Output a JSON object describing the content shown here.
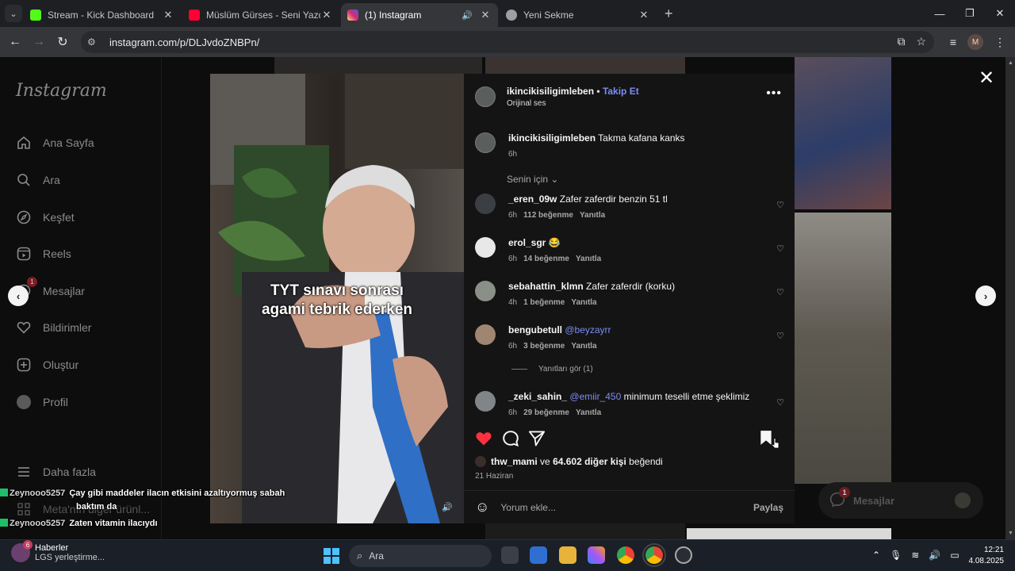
{
  "browser": {
    "tabs": [
      {
        "title": "Stream - Kick Dashboard",
        "favicon_color": "#53fc18",
        "active": false
      },
      {
        "title": "Müslüm Gürses - Seni Yazdım -",
        "favicon_color": "#ff0033",
        "active": false
      },
      {
        "title": "(1) Instagram",
        "favicon_color": "#d62976",
        "active": true
      },
      {
        "title": "Yeni Sekme",
        "favicon_color": "#9aa0a6",
        "active": false
      }
    ],
    "url": "instagram.com/p/DLJvdoZNBPn/",
    "profile_initial": "M"
  },
  "sidebar": {
    "logo": "Instagram",
    "items": [
      {
        "label": "Ana Sayfa",
        "icon": "home-icon"
      },
      {
        "label": "Ara",
        "icon": "search-icon"
      },
      {
        "label": "Keşfet",
        "icon": "compass-icon"
      },
      {
        "label": "Reels",
        "icon": "reels-icon"
      },
      {
        "label": "Mesajlar",
        "icon": "messenger-icon",
        "badge": "1"
      },
      {
        "label": "Bildirimler",
        "icon": "heart-icon"
      },
      {
        "label": "Oluştur",
        "icon": "plus-icon"
      },
      {
        "label": "Profil",
        "icon": "profile-icon"
      }
    ],
    "more": "Daha fazla",
    "meta": "Meta'nın diğer ürünl..."
  },
  "post": {
    "caption_line1": "TYT sınavı sonrası",
    "caption_line2": "agami tebrik ederken",
    "author": "ikincikisiligimleben",
    "follow": "Takip Et",
    "audio": "Orijinal ses",
    "owner_comment": {
      "user": "ikincikisiligimleben",
      "text": "Takma kafana kanks",
      "time": "6h"
    },
    "for_you": "Senin için",
    "comments": [
      {
        "user": "_eren_09w",
        "text": "Zafer zaferdir benzin 51 tl",
        "mention": "",
        "time": "6h",
        "likes": "112 beğenme",
        "reply": "Yanıtla"
      },
      {
        "user": "erol_sgr",
        "text": "😂",
        "mention": "",
        "time": "6h",
        "likes": "14 beğenme",
        "reply": "Yanıtla"
      },
      {
        "user": "sebahattin_klmn",
        "text": "Zafer zaferdir (korku)",
        "mention": "",
        "time": "4h",
        "likes": "1 beğenme",
        "reply": "Yanıtla"
      },
      {
        "user": "bengubetull",
        "text": "",
        "mention": "@beyzayrr",
        "time": "6h",
        "likes": "3 beğenme",
        "reply": "Yanıtla"
      },
      {
        "user": "_zeki_sahin_",
        "text": "minimum teselli etme şeklimiz",
        "mention": "@emiir_450",
        "time": "6h",
        "likes": "29 beğenme",
        "reply": "Yanıtla"
      }
    ],
    "view_replies": "Yanıtları gör (1)",
    "liked_by_user": "thw_mami",
    "liked_by_and": "ve",
    "liked_by_count": "64.602 diğer kişi",
    "liked_by_suffix": "beğendi",
    "date": "21 Haziran",
    "add_comment": "Yorum ekle...",
    "share": "Paylaş",
    "like_color": "#ff3040"
  },
  "messages_pill": {
    "label": "Mesajlar",
    "badge": "1"
  },
  "stream_chat": [
    {
      "user": "Zeynooo5257",
      "text": "Çay gibi maddeler ilacın etkisini azaltıyormuş sabah"
    },
    {
      "user": "",
      "text": "baktım da"
    },
    {
      "user": "Zeynooo5257",
      "text": "Zaten vitamin ilacıydı"
    }
  ],
  "taskbar": {
    "news_title": "Haberler",
    "news_sub": "LGS yerleştirme...",
    "news_badge": "6",
    "search": "Ara",
    "time": "12:21",
    "date": "4.08.2025"
  }
}
